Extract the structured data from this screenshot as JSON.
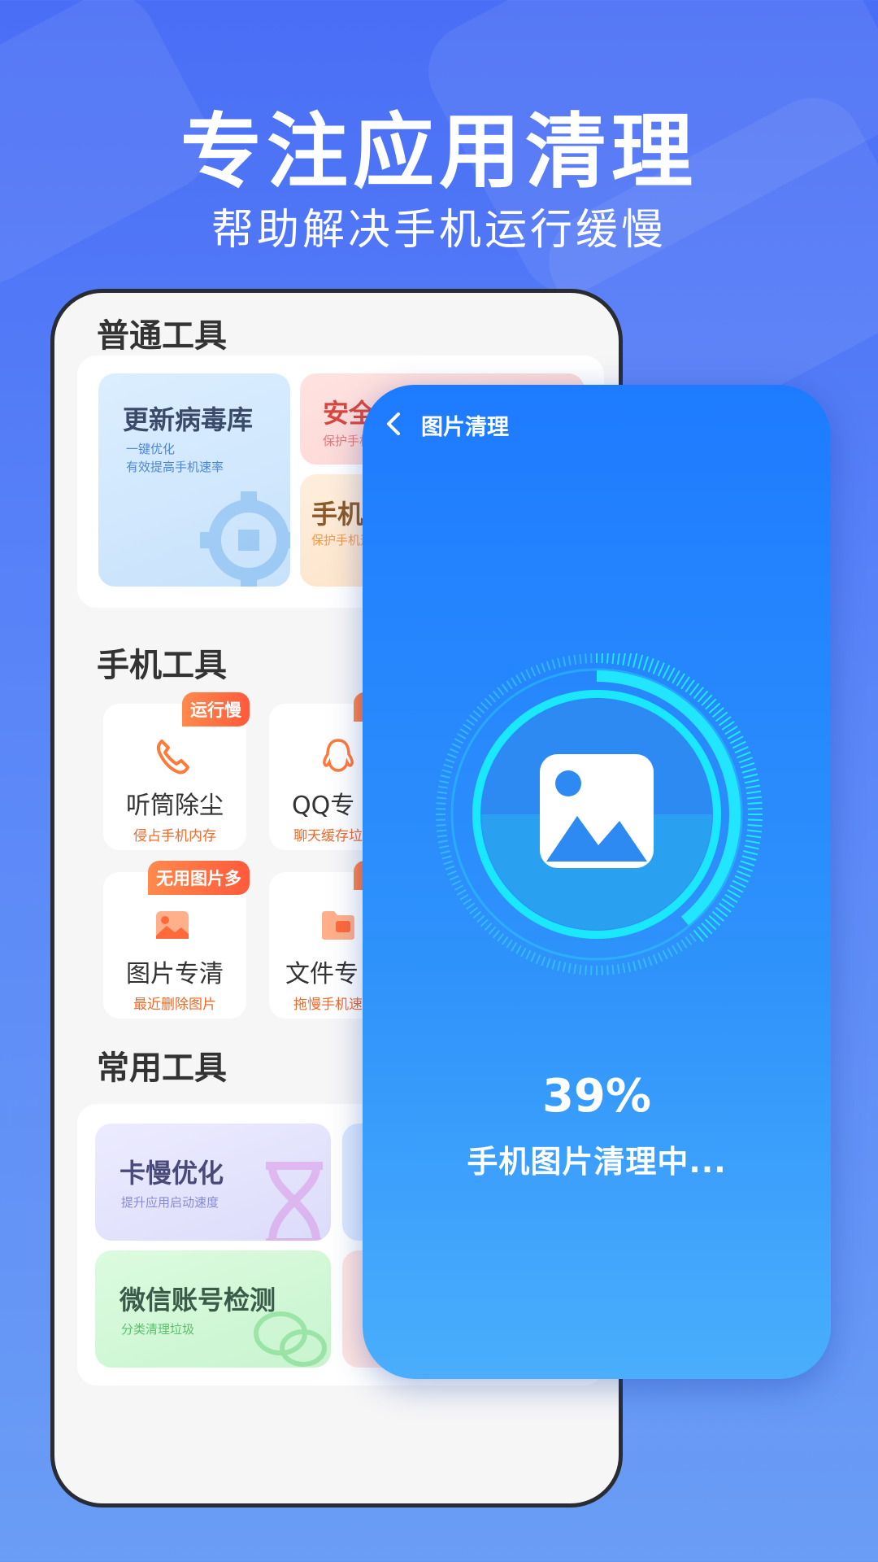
{
  "hero": {
    "title": "专注应用清理",
    "subtitle": "帮助解决手机运行缓慢"
  },
  "phone": {
    "sections": {
      "general": "普通工具",
      "phone_tools": "手机工具",
      "common": "常用工具"
    },
    "general_cards": [
      {
        "title": "更新病毒库",
        "sub1": "一键优化",
        "sub2": "有效提高手机速率"
      },
      {
        "title": "安全检",
        "sub1": "保护手机"
      },
      {
        "title": "手机除",
        "sub1": "保护手机运"
      }
    ],
    "phone_tools": [
      {
        "name": "听筒除尘",
        "sub": "侵占手机内存",
        "tag": "运行慢",
        "icon": "phone-icon"
      },
      {
        "name": "QQ专",
        "sub": "聊天缓存垃",
        "tag": "",
        "icon": "qq-icon"
      },
      {
        "name": "图片专清",
        "sub": "最近删除图片",
        "tag": "无用图片多",
        "icon": "image-icon"
      },
      {
        "name": "文件专",
        "sub": "拖慢手机速",
        "tag": "",
        "icon": "folder-icon"
      }
    ],
    "common_cards": [
      {
        "title": "卡慢优化",
        "sub": "提升应用启动速度"
      },
      {
        "title": "微信账号检测",
        "sub": "分类清理垃圾"
      }
    ]
  },
  "overlay": {
    "back_icon": "chevron-left-icon",
    "title": "图片清理",
    "progress_percent": 39,
    "percent_label": "39%",
    "status": "手机图片清理中..."
  },
  "colors": {
    "accent": "#1e7bff",
    "ring": "#22e6ff",
    "tag": "#ff6a3c"
  }
}
